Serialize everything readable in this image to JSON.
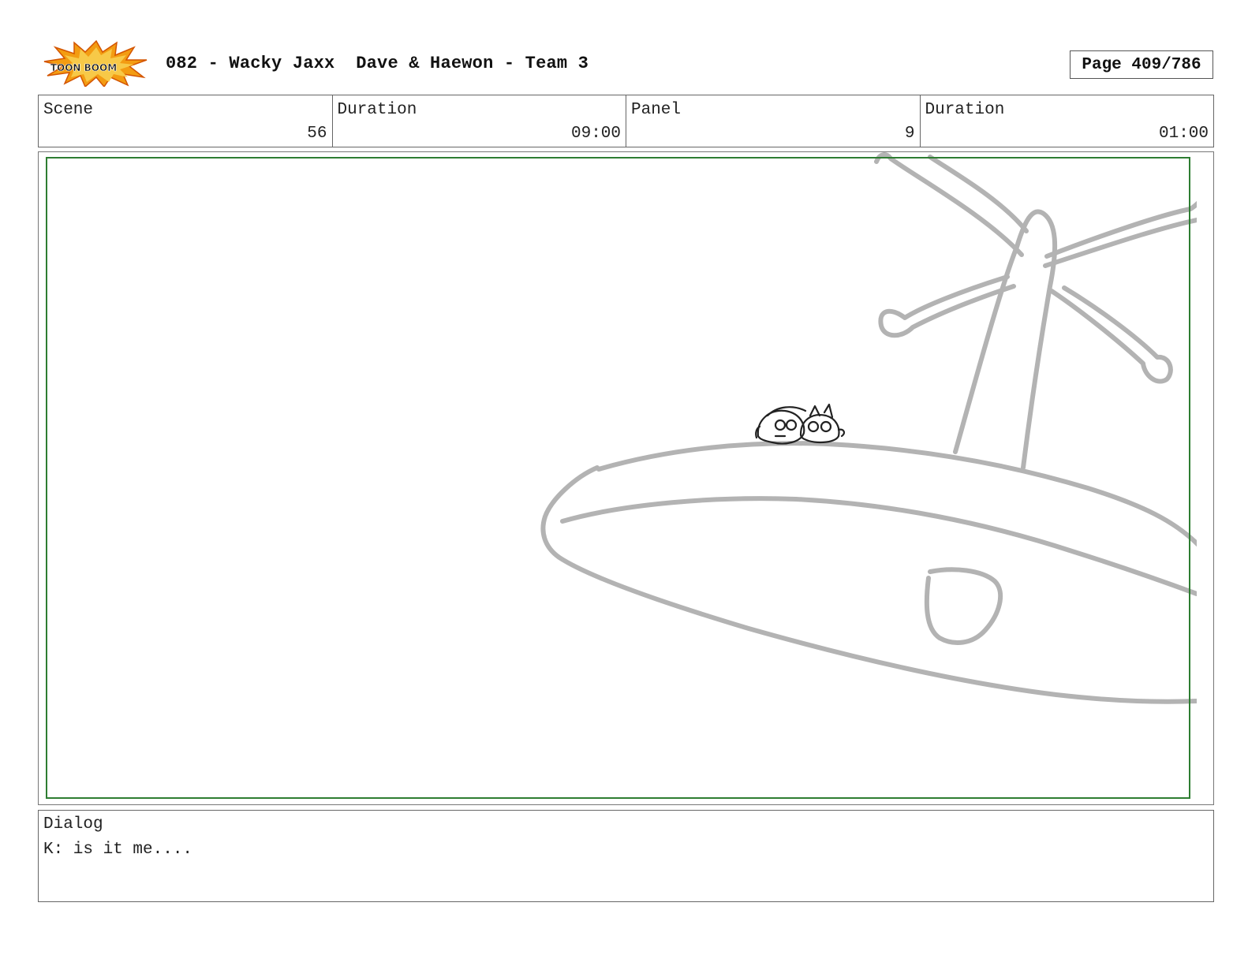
{
  "header": {
    "logo_text": "TOON BOOM",
    "title": "082 - Wacky Jaxx  Dave & Haewon - Team 3",
    "page": "Page 409/786"
  },
  "info": {
    "scene_label": "Scene",
    "scene_value": "56",
    "scene_duration_label": "Duration",
    "scene_duration_value": "09:00",
    "panel_label": "Panel",
    "panel_value": "9",
    "panel_duration_label": "Duration",
    "panel_duration_value": "01:00"
  },
  "dialog": {
    "label": "Dialog",
    "text": "K: is it me...."
  },
  "colors": {
    "safe_frame": "#2e7d32",
    "sketch": "#b3b3b3",
    "logo_burst": "#f39c12"
  }
}
